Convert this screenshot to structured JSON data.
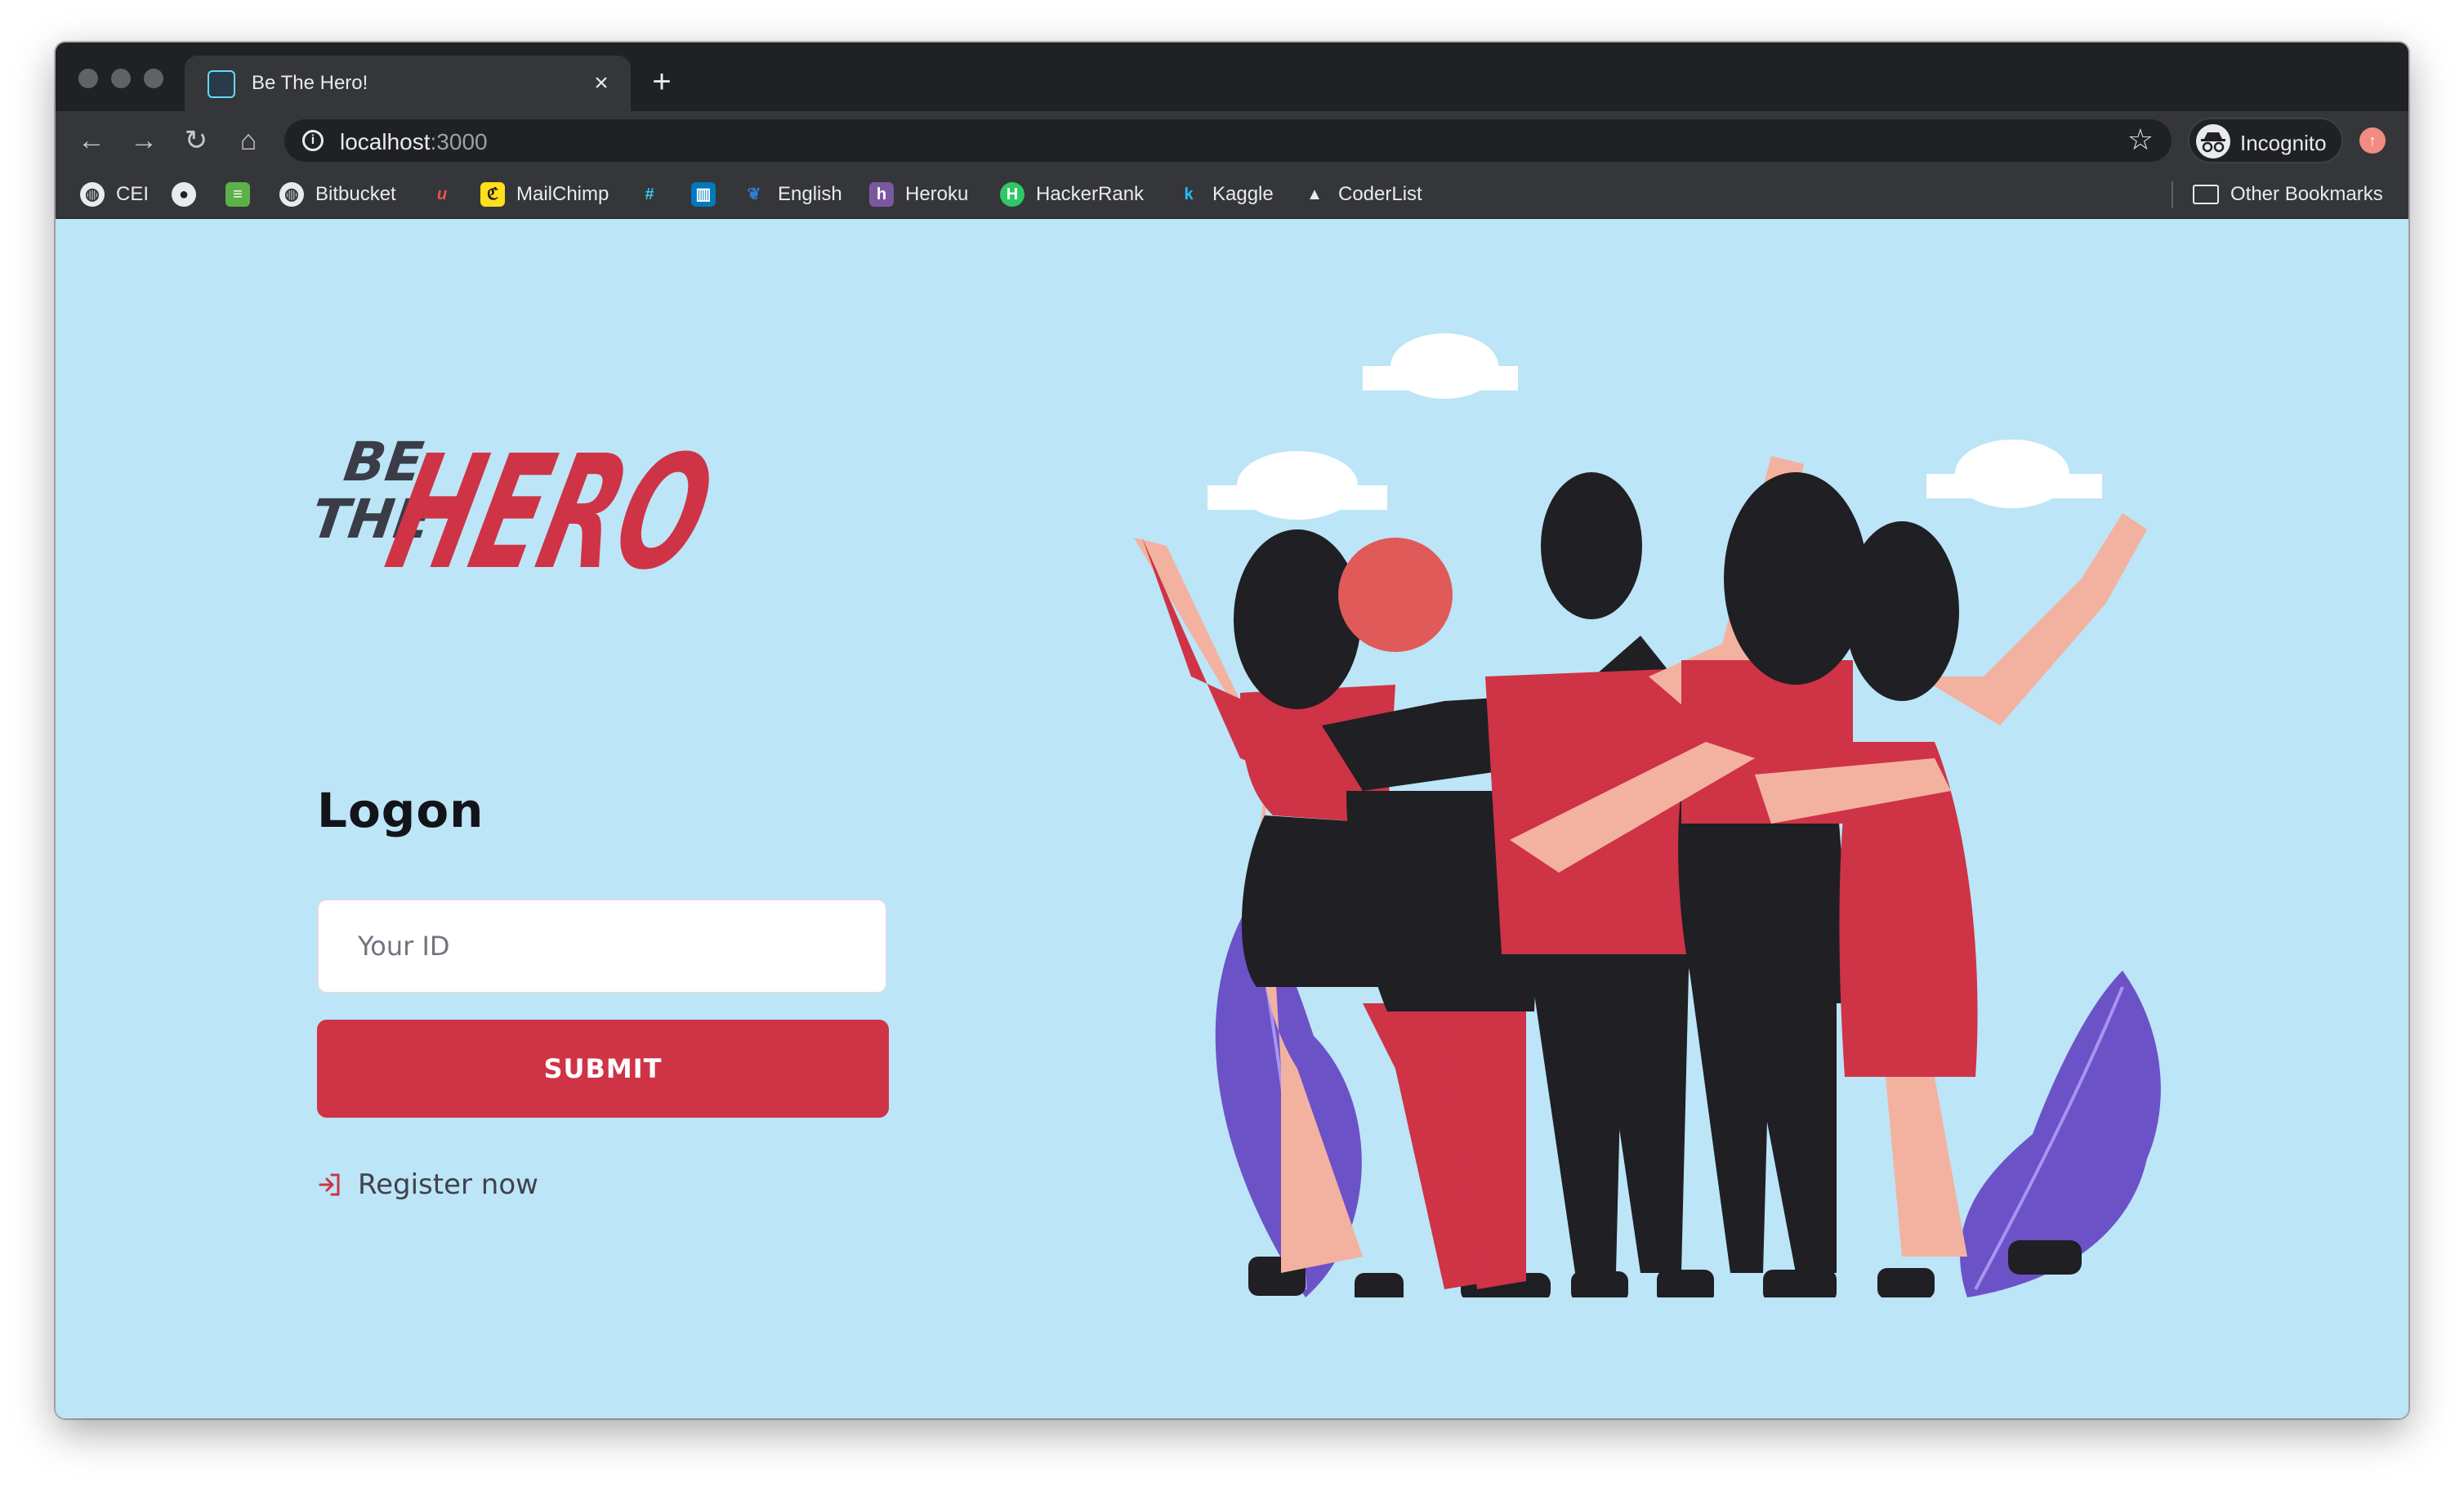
{
  "browser": {
    "tab_title": "Be The Hero!",
    "tab_close": "×",
    "new_tab": "+",
    "url_host": "localhost",
    "url_port": ":3000",
    "profile": "Incognito",
    "bookmarks": [
      {
        "label": "CEI",
        "icon": "globe-icon"
      },
      {
        "label": "",
        "icon": "github-icon"
      },
      {
        "label": "",
        "icon": "stackoverflow-icon"
      },
      {
        "label": "Bitbucket",
        "icon": "globe-icon"
      },
      {
        "label": "",
        "icon": "udemy-icon"
      },
      {
        "label": "MailChimp",
        "icon": "mailchimp-icon"
      },
      {
        "label": "",
        "icon": "slack-icon"
      },
      {
        "label": "",
        "icon": "trello-icon"
      },
      {
        "label": "English",
        "icon": "english-icon"
      },
      {
        "label": "Heroku",
        "icon": "heroku-icon"
      },
      {
        "label": "HackerRank",
        "icon": "hackerrank-icon"
      },
      {
        "label": "Kaggle",
        "icon": "kaggle-icon"
      },
      {
        "label": "CoderList",
        "icon": "coderlist-icon"
      }
    ],
    "other_bookmarks": "Other Bookmarks"
  },
  "page": {
    "logo_line1": "BE",
    "logo_line2": "THE",
    "logo_word": "HERO",
    "heading": "Logon",
    "id_placeholder": "Your ID",
    "submit_label": "SUBMIT",
    "register_label": "Register now",
    "colors": {
      "background": "#bce5f7",
      "brand_red": "#cf3346",
      "text_dark": "#13131a"
    }
  }
}
